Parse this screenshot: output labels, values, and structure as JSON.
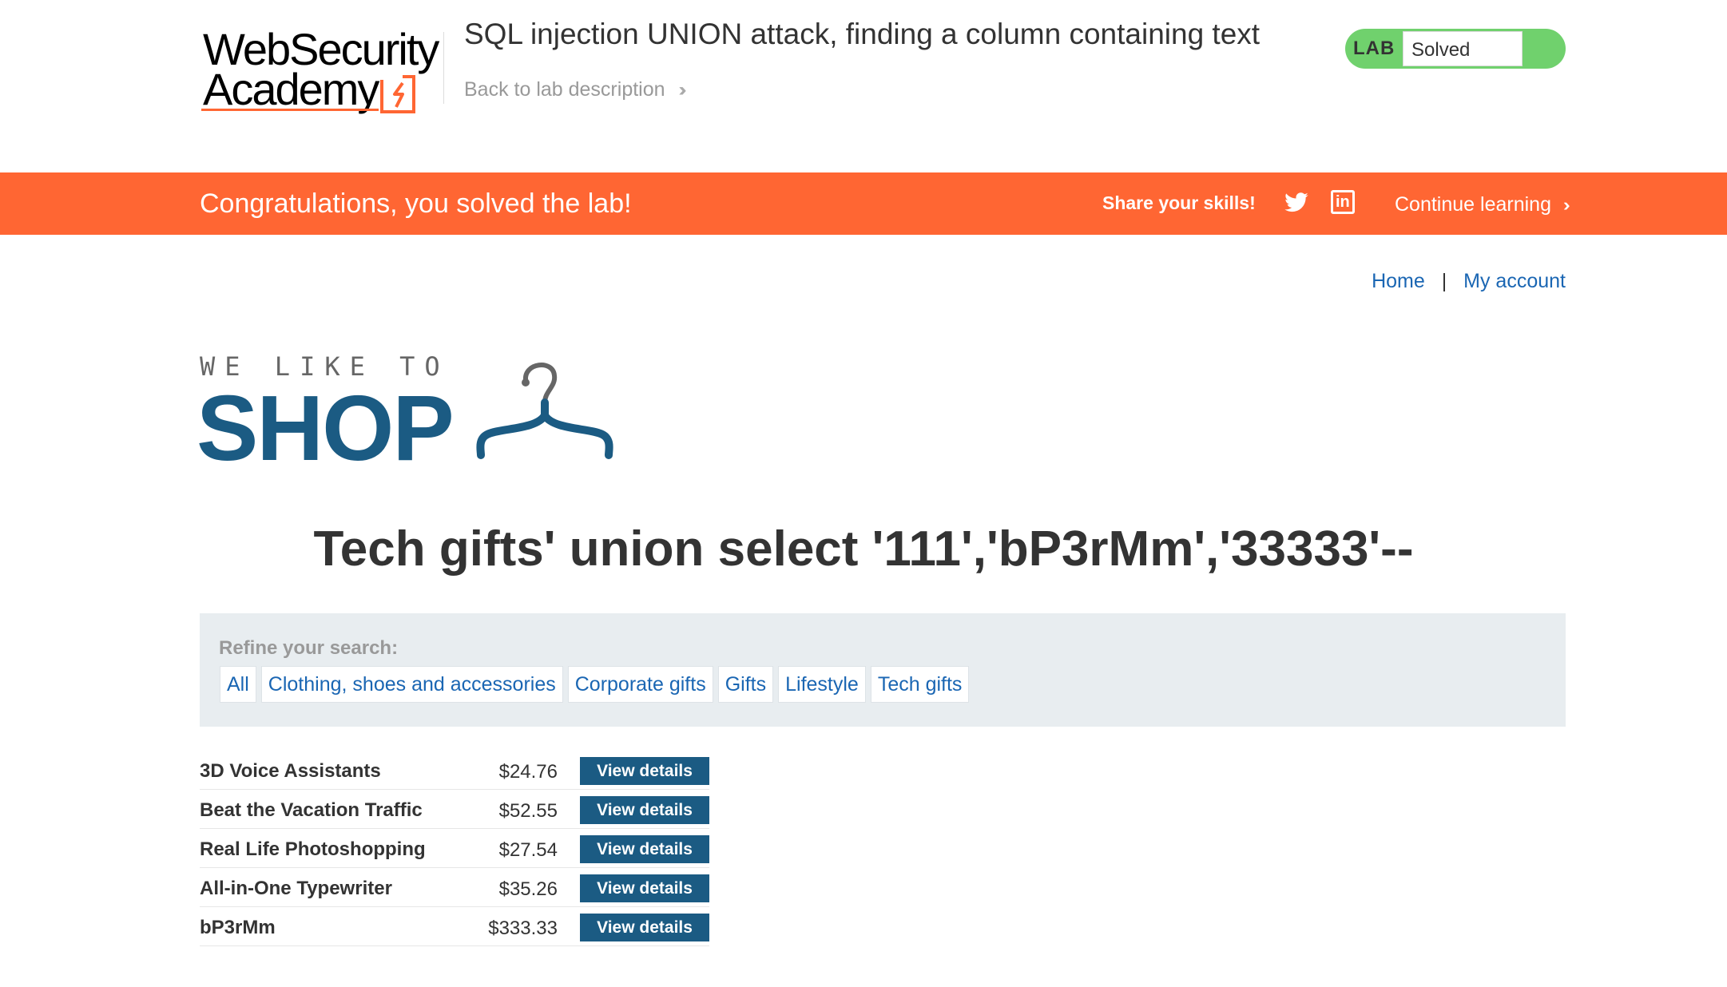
{
  "academy": {
    "logo_line1": "WebSecurity",
    "logo_line2": "Academy",
    "lab_title": "SQL injection UNION attack, finding a column containing text",
    "back_link": "Back to lab description",
    "lab_badge": "LAB",
    "lab_status": "Solved",
    "status_color": "#70d16d"
  },
  "banner": {
    "message": "Congratulations, you solved the lab!",
    "share_label": "Share your skills!",
    "continue_label": "Continue learning",
    "color": "#ff6633"
  },
  "nav": {
    "home": "Home",
    "separator": "|",
    "account": "My account"
  },
  "shop_logo": {
    "tagline": "WE LIKE TO",
    "word": "SHOP"
  },
  "search_heading": "Tech gifts' union select '111','bP3rMm','33333'--",
  "filter": {
    "refine_label": "Refine your search:",
    "categories": [
      "All",
      "Clothing, shoes and accessories",
      "Corporate gifts",
      "Gifts",
      "Lifestyle",
      "Tech gifts"
    ]
  },
  "products": [
    {
      "name": "3D Voice Assistants",
      "price": "$24.76",
      "button": "View details"
    },
    {
      "name": "Beat the Vacation Traffic",
      "price": "$52.55",
      "button": "View details"
    },
    {
      "name": "Real Life Photoshopping",
      "price": "$27.54",
      "button": "View details"
    },
    {
      "name": "All-in-One Typewriter",
      "price": "$35.26",
      "button": "View details"
    },
    {
      "name": "bP3rMm",
      "price": "$333.33",
      "button": "View details"
    }
  ]
}
